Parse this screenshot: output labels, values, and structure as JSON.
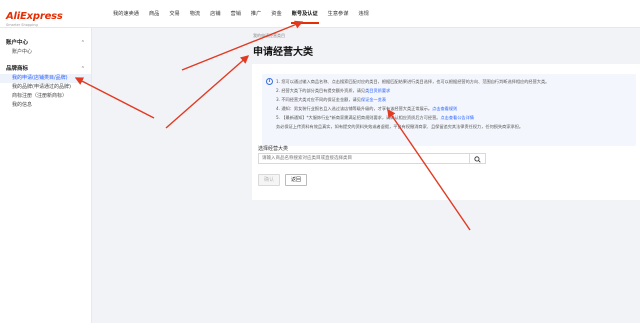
{
  "logo": {
    "brand": "AliExpress",
    "tagline": "Smarter Shopping"
  },
  "nav": {
    "items": [
      "我的速卖通",
      "商品",
      "交易",
      "物流",
      "店铺",
      "营销",
      "推广",
      "资金",
      "账号及认证",
      "生意参谋",
      "违规"
    ],
    "active": "账号及认证"
  },
  "sidebar": {
    "groups": [
      {
        "title": "账户中心",
        "items": [
          "账户中心"
        ]
      },
      {
        "title": "品牌商标",
        "items": [
          "我的申请(店铺类目/品牌)",
          "我的品牌(申请通过的品牌)",
          "商标注册（注册新商标）",
          "我的信息"
        ]
      }
    ],
    "active_item": "我的申请(店铺类目/品牌)"
  },
  "main": {
    "breadcrumb": "我的申请经营类目",
    "title": "申请经营大类",
    "notice": {
      "lines": [
        {
          "text": "1. 您可以通过输入商品名称、点击搜索匹配对应的类目，根据匹配结果进行类目选择，也可以根据经营的方向、范围自行判断选择相应的经营大类。",
          "link": ""
        },
        {
          "text": "2. 经营大类下的部分类目有提交额外资质，请见",
          "link": "类目资质要求"
        },
        {
          "text": "3. 不同经营大类对应不同的保证金金额，请见",
          "link": "保证金一览表"
        },
        {
          "text": "4. 通知：男女装行业报名且入选过该店铺等级升级的，才享有该经营大类正常展示。",
          "link": "点击查看规则"
        },
        {
          "text": "5. 【最新通知】*大服饰行业*新商家需满足招商规则要求，请确认相应资质后方可经营。",
          "link": "点击查看公告详情"
        },
        {
          "text": "务必保证上传资料有效且真实，如有提交的资料失效或者虚假，平台有权撤消商家、且保留追究其法律责任权力，任何损失商家承担。",
          "link": ""
        }
      ]
    },
    "search": {
      "label": "选择经营大类",
      "placeholder": "请输入商品名称搜索对应类目或直接选择类目"
    },
    "buttons": {
      "confirm": "确认",
      "back": "返回"
    }
  },
  "colors": {
    "accent": "#e62e04",
    "link": "#2962ff",
    "arrow": "#e23a22"
  },
  "icons": {
    "search": "search-icon",
    "info": "info-icon",
    "collapse": "chevron-up-icon"
  }
}
